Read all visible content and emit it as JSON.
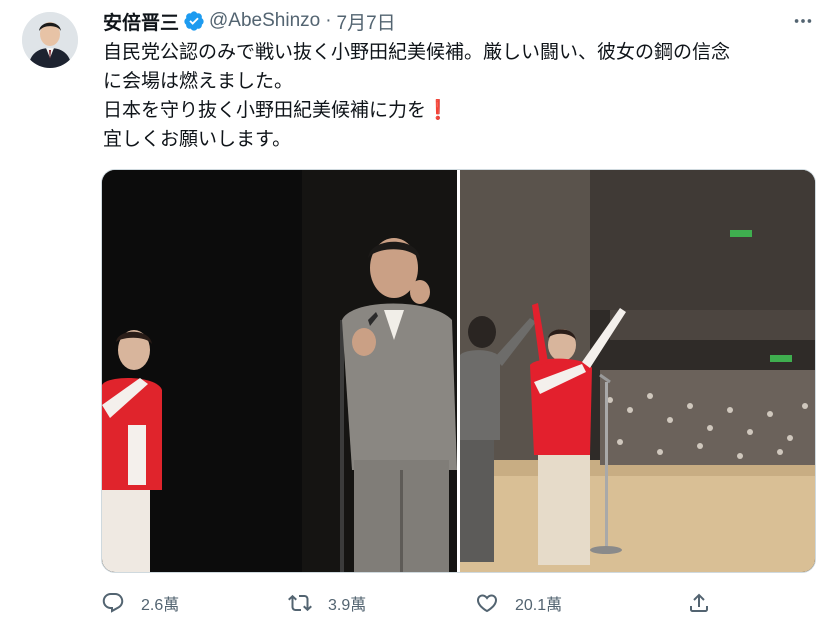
{
  "tweet": {
    "author_name": "安倍晋三",
    "handle": "@AbeShinzo",
    "separator": "·",
    "date": "7月7日",
    "text_lines": [
      "自民党公認のみで戦い抜く小野田紀美候補。厳しい闘い、彼女の鋼の信念",
      "に会場は燃えました。",
      "日本を守り抜く小野田紀美候補に力を",
      "宜しくお願いします。"
    ],
    "verified": true
  },
  "actions": {
    "reply_count": "2.6萬",
    "retweet_count": "3.9萬",
    "like_count": "20.1萬"
  },
  "icons": {
    "avatar": "avatar-photo",
    "verified": "verified-badge-icon",
    "more": "more-horizontal-icon",
    "reply": "reply-icon",
    "retweet": "retweet-icon",
    "like": "heart-icon",
    "share": "share-icon",
    "exclamation": "red-exclamation-emoji"
  },
  "colors": {
    "text": "#0f1419",
    "secondary": "#536471",
    "verified": "#1d9bf0",
    "border": "#cfd9de",
    "emoji": "#d0021b"
  }
}
